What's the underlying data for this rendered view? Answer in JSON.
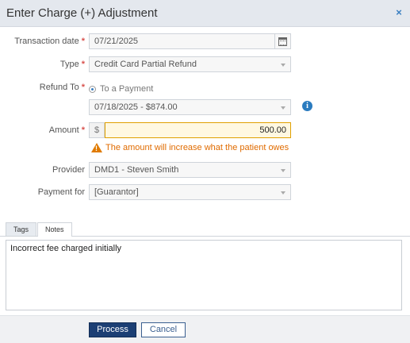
{
  "dialog": {
    "title": "Enter Charge (+) Adjustment",
    "close_icon": "×"
  },
  "form": {
    "transaction_date": {
      "label": "Transaction date",
      "required": "*",
      "value": "07/21/2025",
      "icon": "calendar-icon"
    },
    "type": {
      "label": "Type",
      "required": "*",
      "value": "Credit Card Partial Refund"
    },
    "refund_to": {
      "label": "Refund To",
      "required": "*",
      "option": "To a Payment"
    },
    "payment_select": {
      "value": "07/18/2025 - $874.00",
      "info_icon": "i"
    },
    "amount": {
      "label": "Amount",
      "required": "*",
      "prefix": "$",
      "value": "500.00"
    },
    "warning": {
      "icon": "!",
      "text": "The amount will increase what the patient owes"
    },
    "provider": {
      "label": "Provider",
      "value": "DMD1 - Steven Smith"
    },
    "payment_for": {
      "label": "Payment for",
      "value": "[Guarantor]"
    }
  },
  "tabs": [
    {
      "label": "Tags",
      "active": false
    },
    {
      "label": "Notes",
      "active": true
    }
  ],
  "notes": {
    "text": "Incorrect fee charged initially"
  },
  "footer": {
    "process_label": "Process",
    "cancel_label": "Cancel"
  },
  "colors": {
    "primary": "#1c3f74",
    "warning": "#e06b00",
    "required": "#d9534f",
    "info": "#2a7bbf",
    "amount_highlight": "#fff8e1"
  }
}
